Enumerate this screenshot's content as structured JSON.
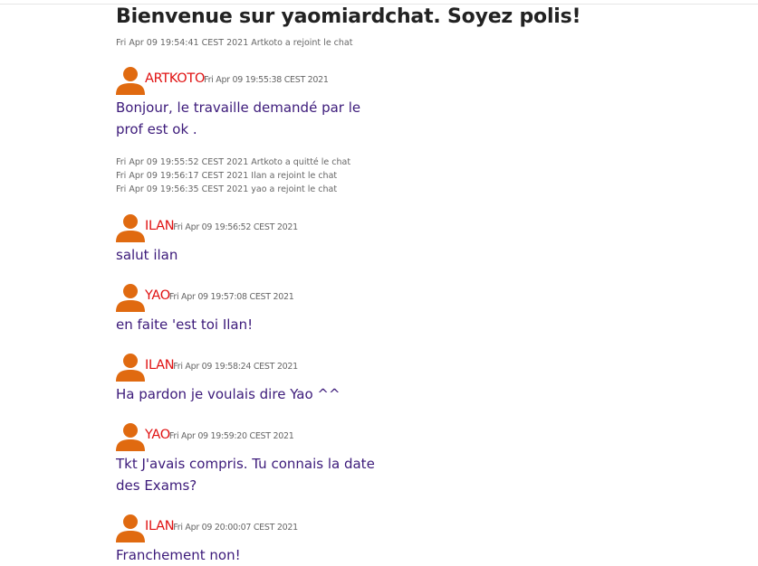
{
  "title": "Bienvenue sur yaomiardchat. Soyez polis!",
  "events": [
    "Fri Apr 09 19:54:41 CEST 2021 Artkoto a rejoint le chat"
  ],
  "messages": [
    {
      "user": "ARTKOTO",
      "time": "Fri Apr 09 19:55:38 CEST 2021",
      "text": "Bonjour, le travaille demandé par le prof est ok ."
    },
    {
      "user": "ILAN",
      "time": "Fri Apr 09 19:56:52 CEST 2021",
      "text": "salut ilan"
    },
    {
      "user": "YAO",
      "time": "Fri Apr 09 19:57:08 CEST 2021",
      "text": "en faite 'est toi Ilan!"
    },
    {
      "user": "ILAN",
      "time": "Fri Apr 09 19:58:24 CEST 2021",
      "text": "Ha pardon je voulais dire Yao ^^"
    },
    {
      "user": "YAO",
      "time": "Fri Apr 09 19:59:20 CEST 2021",
      "text": "Tkt J'avais compris. Tu connais la date des Exams?"
    },
    {
      "user": "ILAN",
      "time": "Fri Apr 09 20:00:07 CEST 2021",
      "text": "Franchement non!"
    }
  ],
  "events_mid": [
    "Fri Apr 09 19:55:52 CEST 2021 Artkoto a quitté le chat",
    "Fri Apr 09 19:56:17 CEST 2021 Ilan a rejoint le chat",
    "Fri Apr 09 19:56:35 CEST 2021 yao a rejoint le chat"
  ],
  "colors": {
    "avatar": "#e06a10",
    "username": "#e01010",
    "message_text": "#3c1a7a"
  },
  "icons": {
    "avatar": "user-avatar-icon"
  }
}
